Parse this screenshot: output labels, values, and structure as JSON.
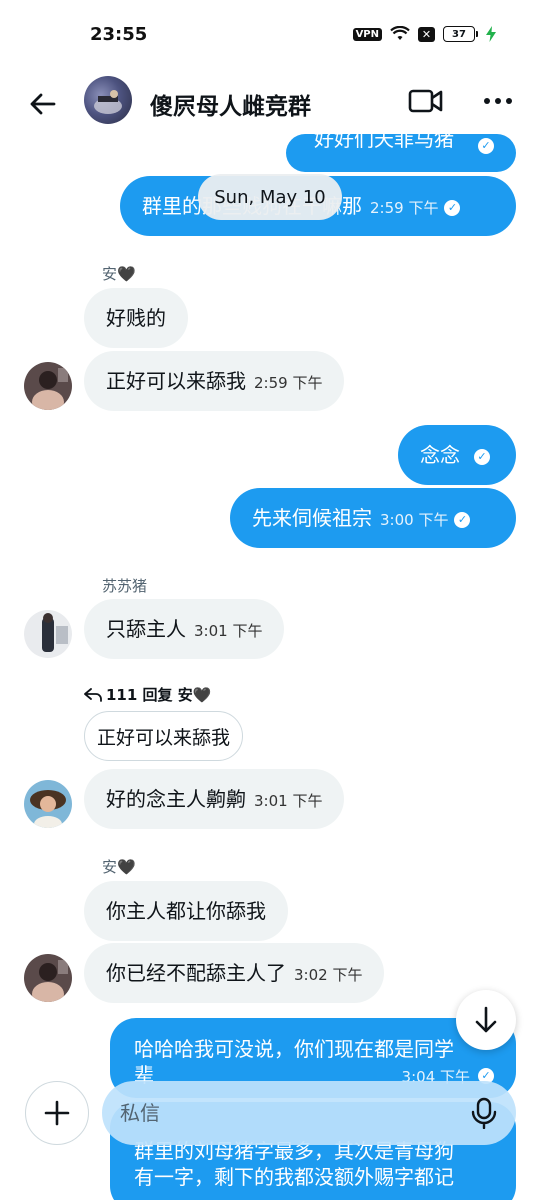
{
  "status_bar": {
    "time": "23:55",
    "vpn": "VPN",
    "battery": "37"
  },
  "header": {
    "title": "傻屄母人雌竞群"
  },
  "date_divider": "Sun, May 10",
  "messages": [
    {
      "text": "好好们天菲马猪",
      "time": ""
    },
    {
      "text": "群里的那些贱狗在干嘛那",
      "time": "2:59 下午"
    },
    {
      "sender": "安🖤",
      "text": "好贱的"
    },
    {
      "text": "正好可以来舔我",
      "time": "2:59 下午"
    },
    {
      "text": "念念"
    },
    {
      "text": "先来伺候祖宗",
      "time": "3:00 下午"
    },
    {
      "sender": "苏苏猪",
      "text": "只舔主人",
      "time": "3:01 下午"
    },
    {
      "reply_meta": "111 回复 安🖤",
      "reply_quote": "正好可以来舔我",
      "text": "好的念主人齁齁",
      "time": "3:01 下午"
    },
    {
      "sender": "安🖤",
      "text": "你主人都让你舔我"
    },
    {
      "text": "你已经不配舔主人了",
      "time": "3:02 下午"
    },
    {
      "text_line1": "哈哈哈我可没说，你们现在都是同学",
      "text_line2": "辈",
      "time": "3:04 下午"
    },
    {
      "text_line1": "群里的刘母猪字最多，其次是青母狗",
      "text_line2": "有一字，剩下的我都没额外赐字都记"
    }
  ],
  "composer": {
    "placeholder": "私信"
  },
  "colors": {
    "accent": "#1d9bf0",
    "incoming_bubble": "#eff3f4",
    "input_bg": "#bee2fc"
  }
}
